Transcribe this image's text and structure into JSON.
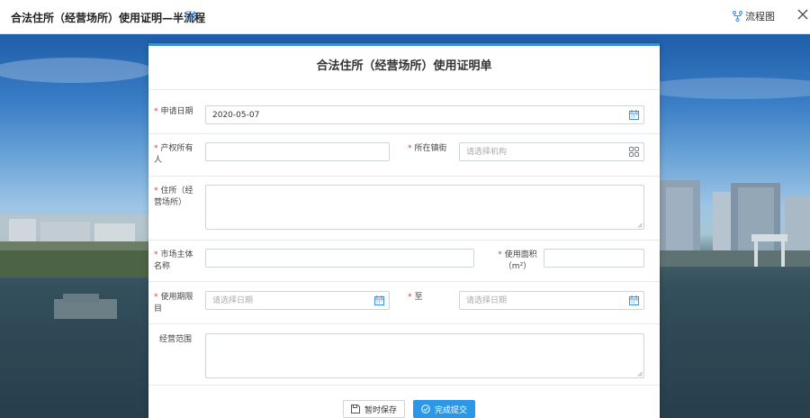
{
  "window": {
    "title": "合法住所（经营场所）使用证明—半流程",
    "flow_label": "流程图"
  },
  "form": {
    "heading": "合法住所（经营场所）使用证明单",
    "apply_date": {
      "label": "申请日期",
      "value": "2020-05-07"
    },
    "owner": {
      "label": "产权所有人",
      "value": ""
    },
    "street": {
      "label": "所在镇街",
      "placeholder": "请选择机构"
    },
    "address": {
      "label": "住所（经营场所）",
      "value": ""
    },
    "entity": {
      "label": "市场主体名称",
      "value": ""
    },
    "area": {
      "label_line1": "使用面积",
      "label_line2": "（m²）",
      "value": ""
    },
    "period_start": {
      "label": "使用期限目",
      "placeholder": "请选择日期"
    },
    "period_end": {
      "label": "至",
      "placeholder": "请选择日期"
    },
    "scope": {
      "label": "经营范围",
      "value": ""
    }
  },
  "buttons": {
    "save": "暂时保存",
    "submit": "完成提交"
  },
  "colors": {
    "accent": "#2a97e8",
    "required": "#e03b3b",
    "icon": "#3b8fe0"
  }
}
